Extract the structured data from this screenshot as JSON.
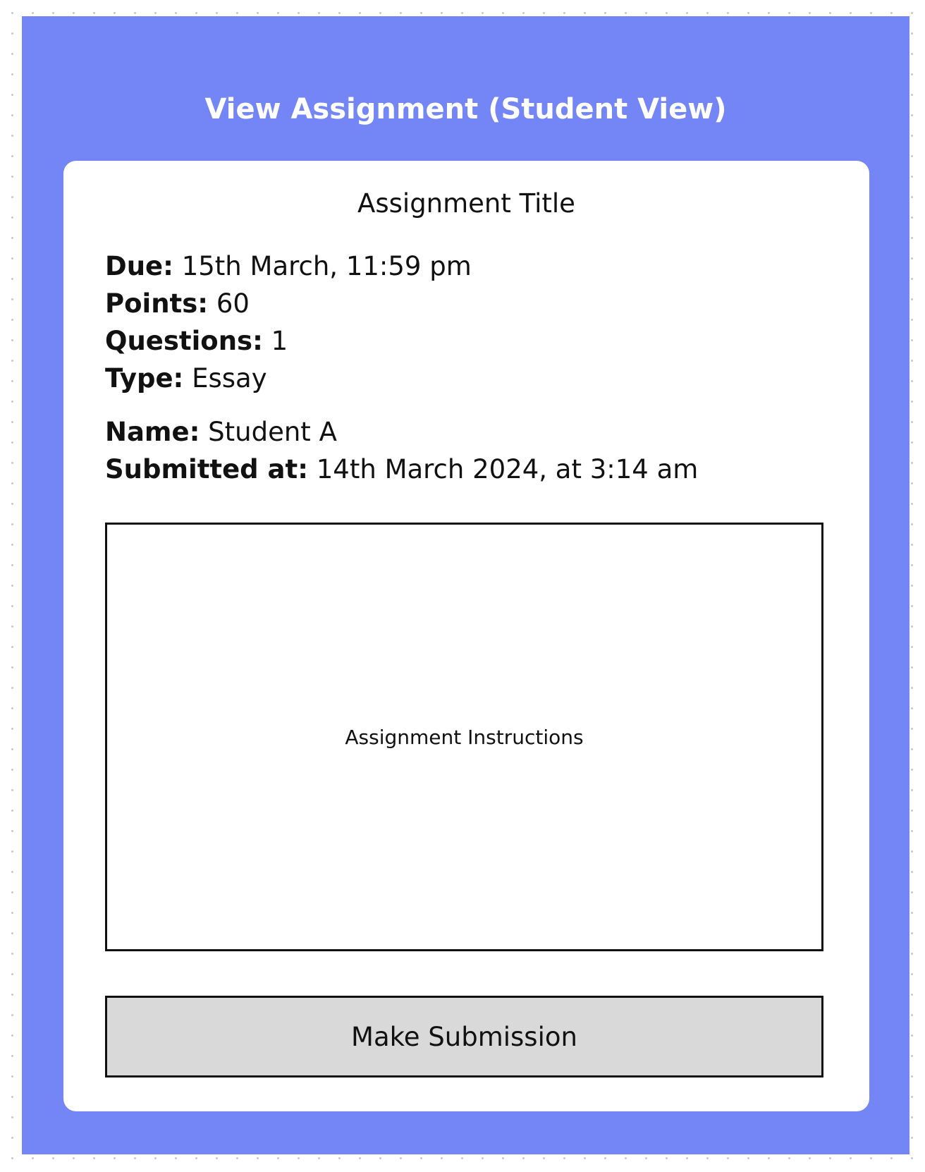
{
  "header": {
    "title": "View Assignment (Student View)"
  },
  "assignment": {
    "title": "Assignment Title",
    "details": [
      {
        "label": "Due:",
        "value": "15th March, 11:59 pm"
      },
      {
        "label": "Points:",
        "value": "60"
      },
      {
        "label": "Questions:",
        "value": "1"
      },
      {
        "label": "Type:",
        "value": "Essay"
      }
    ],
    "submission": [
      {
        "label": "Name:",
        "value": "Student A"
      },
      {
        "label": "Submitted at:",
        "value": "14th March 2024, at 3:14 am"
      }
    ],
    "instructions": "Assignment Instructions"
  },
  "actions": {
    "submit_label": "Make Submission"
  },
  "colors": {
    "frame_background": "#7486f5",
    "card_background": "#ffffff",
    "button_background": "#d9d9d9"
  }
}
